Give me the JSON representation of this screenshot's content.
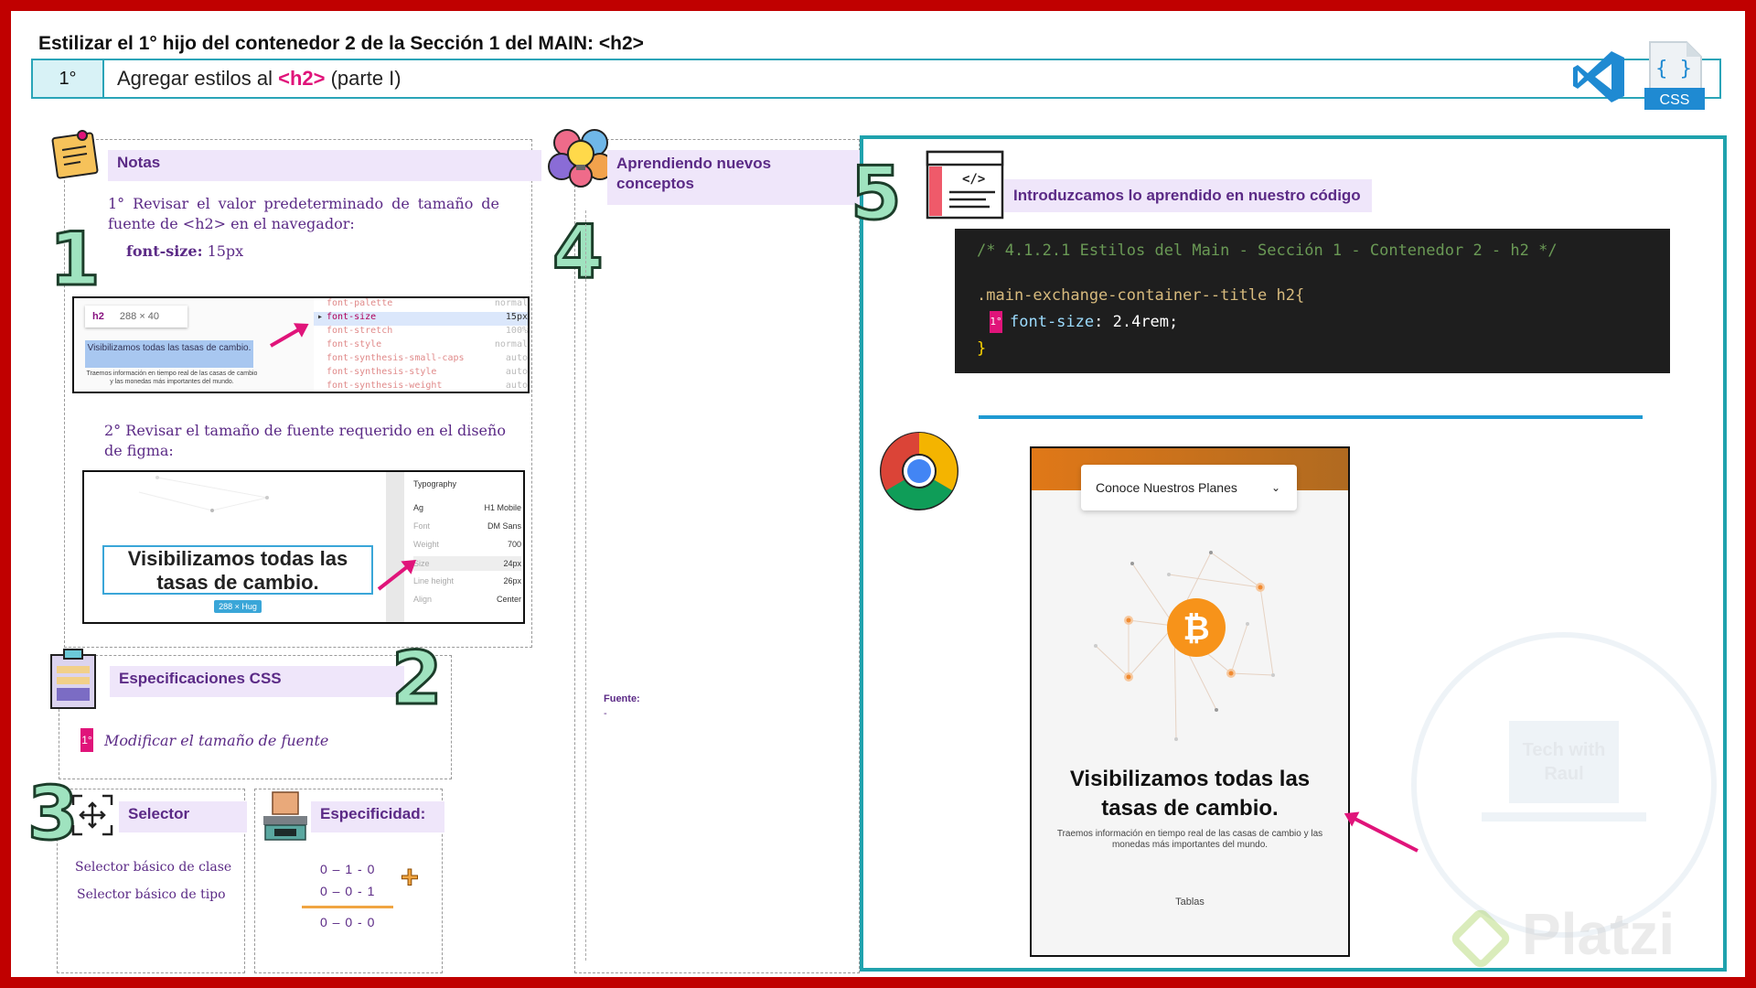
{
  "title": "Estilizar el 1° hijo del contenedor 2 de la Sección 1 del MAIN: <h2>",
  "step": {
    "number": "1°",
    "prefix": "Agregar estilos al ",
    "tag": "<h2>",
    "suffix": " (parte I)"
  },
  "notes": {
    "header": "Notas",
    "item1": "1° Revisar el valor predeterminado de tamaño de fuente de <h2> en el navegador:",
    "font_size_label": "font-size:",
    "font_size_value": " 15px",
    "item2": "2° Revisar el tamaño de fuente requerido en el diseño de figma:"
  },
  "devtools": {
    "tag": "h2",
    "size": "288 × 40",
    "preview_title": "Visibilizamos todas las tasas de cambio.",
    "preview_text": "Traemos información en tiempo real de las casas de cambio y las monedas más importantes del mundo.",
    "props": [
      {
        "name": "font-palette",
        "value": "normal"
      },
      {
        "name": "font-size",
        "value": "15px"
      },
      {
        "name": "font-stretch",
        "value": "100%"
      },
      {
        "name": "font-style",
        "value": "normal"
      },
      {
        "name": "font-synthesis-small-caps",
        "value": "auto"
      },
      {
        "name": "font-synthesis-style",
        "value": "auto"
      },
      {
        "name": "font-synthesis-weight",
        "value": "auto"
      }
    ]
  },
  "figma": {
    "heading_line1": "Visibilizamos todas las",
    "heading_line2": "tasas de cambio.",
    "badge": "288 × Hug",
    "panel_title": "Typography",
    "rows": [
      {
        "k": "Ag",
        "v": "H1 Mobile"
      },
      {
        "k": "Font",
        "v": "DM Sans"
      },
      {
        "k": "Weight",
        "v": "700"
      },
      {
        "k": "Size",
        "v": "24px"
      },
      {
        "k": "Line height",
        "v": "26px"
      },
      {
        "k": "Align",
        "v": "Center"
      }
    ]
  },
  "css_specs": {
    "header": "Especificaciones CSS",
    "marker": "1°",
    "item": "Modificar el tamaño de fuente"
  },
  "selector": {
    "header": "Selector",
    "items": [
      "Selector básico de clase",
      "Selector básico de tipo"
    ]
  },
  "specificity": {
    "header": "Especificidad:",
    "row1": "0 – 1 - 0",
    "row2": "0 – 0 - 1",
    "result": "0 – 0 - 0",
    "plus": "+"
  },
  "concepts": {
    "header_line1": "Aprendiendo nuevos",
    "header_line2": "conceptos",
    "source_label": "Fuente:",
    "source_value": "-"
  },
  "code_section": {
    "header": "Introduzcamos lo aprendido en nuestro código",
    "comment": "/* 4.1.2.1 Estilos del Main - Sección 1 - Contenedor 2 - h2 */",
    "selector": ".main-exchange-container--title h2{",
    "marker": "1°",
    "property": "font-size",
    "value": "2.4rem;",
    "close": "}"
  },
  "phone": {
    "dropdown": "Conoce Nuestros Planes",
    "heading_line1": "Visibilizamos todas las",
    "heading_line2": "tasas de cambio.",
    "paragraph": "Traemos información en tiempo real de las casas de cambio y las monedas más importantes del mundo.",
    "link": "Tablas"
  },
  "numbers": [
    "1",
    "2",
    "3",
    "4",
    "5"
  ],
  "icons": {
    "css_label": "CSS",
    "css_braces": "{ }"
  },
  "watermark": {
    "brand": "Platzi",
    "sticker_line1": "Tech with",
    "sticker_line2": "Raul"
  },
  "colors": {
    "frame": "#c00000",
    "accent_teal": "#1fa2ad",
    "accent_pink": "#e0147a",
    "header_purple": "#5b2a86",
    "header_bg": "#efe6fa"
  }
}
